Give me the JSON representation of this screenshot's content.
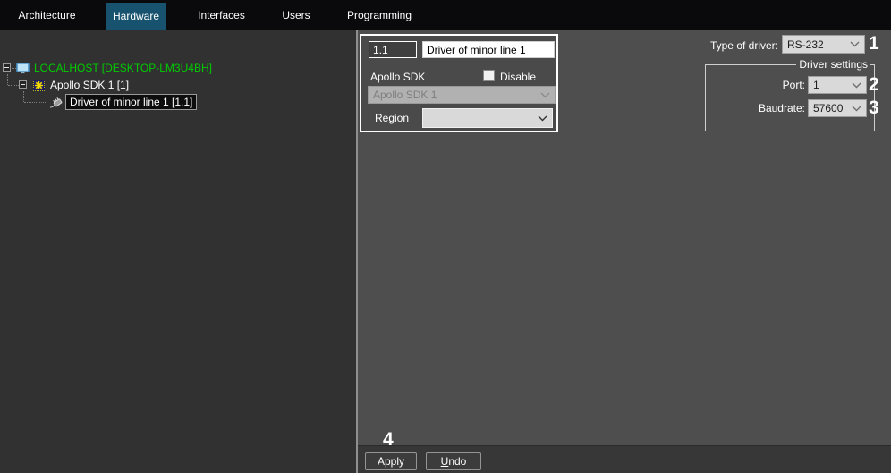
{
  "tabs": [
    {
      "label": "Architecture",
      "active": false
    },
    {
      "label": "Hardware",
      "active": true
    },
    {
      "label": "Interfaces",
      "active": false
    },
    {
      "label": "Users",
      "active": false
    },
    {
      "label": "Programming",
      "active": false
    }
  ],
  "tree": {
    "items": [
      {
        "label": "LOCALHOST [DESKTOP-LM3U4BH]",
        "icon": "computer-icon",
        "expanded": true,
        "selected": false
      },
      {
        "label": "Apollo SDK 1 [1]",
        "icon": "apollo-asterisk-icon",
        "expanded": true,
        "selected": false
      },
      {
        "label": "Driver of minor line 1 [1.1]",
        "icon": "driver-plug-icon",
        "expanded": false,
        "selected": true
      }
    ]
  },
  "form": {
    "id_value": "1.1",
    "name_value": "Driver of minor line 1",
    "sdk_label": "Apollo SDK",
    "disable_label": "Disable",
    "disable_checked": false,
    "sdk_value": "Apollo SDK 1",
    "region_label": "Region",
    "region_value": ""
  },
  "driver": {
    "type_label": "Type of driver:",
    "type_value": "RS-232",
    "settings_label": "Driver settings",
    "port_label": "Port:",
    "port_value": "1",
    "baudrate_label": "Baudrate:",
    "baudrate_value": "57600"
  },
  "buttons": {
    "apply": "Apply",
    "undo_accel": "U",
    "undo_rest": "ndo"
  },
  "annotations": {
    "one": "1",
    "two": "2",
    "three": "3",
    "four": "4"
  },
  "colors": {
    "header_bg": "#0a0a0c",
    "active_tab": "#17536f",
    "tree_bg": "#313131",
    "panel_bg": "#4e4e4e",
    "bottombar_bg": "#373737",
    "host_green": "#00cc00",
    "combo_bg": "#d9d9d9",
    "disabled_combo_bg": "#b1b1b1",
    "apollo_yellow": "#f5dc00"
  }
}
